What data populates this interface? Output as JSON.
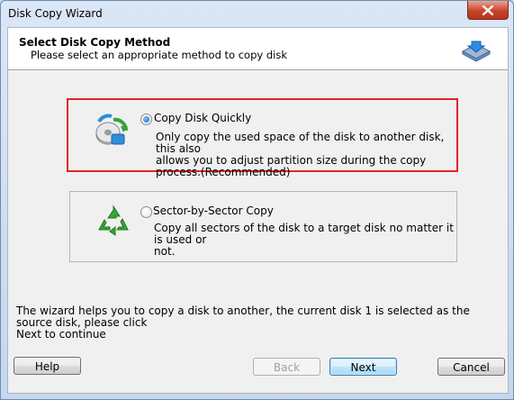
{
  "window": {
    "title": "Disk Copy Wizard",
    "close_icon": "close-icon"
  },
  "header": {
    "title": "Select Disk Copy Method",
    "subtitle": "Please select an appropriate method to copy disk",
    "icon": "disk-copy-icon"
  },
  "options": [
    {
      "label": "Copy Disk Quickly",
      "selected": true,
      "highlighted": true,
      "icon": "disk-quick-copy-icon",
      "description_lines": [
        "Only copy the used space of the disk to another disk, this also",
        "allows you to adjust partition size during the copy",
        "process.(Recommended)"
      ]
    },
    {
      "label": "Sector-by-Sector Copy",
      "selected": false,
      "highlighted": false,
      "icon": "recycle-icon",
      "description_lines": [
        "Copy all sectors of the disk to a target disk no matter it is used or",
        "not."
      ]
    }
  ],
  "footer": {
    "info_lines": [
      "The wizard helps you to copy a disk to another, the current disk 1 is selected as the source disk, please click",
      "Next to continue"
    ]
  },
  "buttons": {
    "help": "Help",
    "back": "Back",
    "next": "Next",
    "cancel": "Cancel"
  },
  "colors": {
    "highlight_border": "#e0262a",
    "title_bar": "#c5d7ee",
    "close_button": "#c7452c"
  }
}
